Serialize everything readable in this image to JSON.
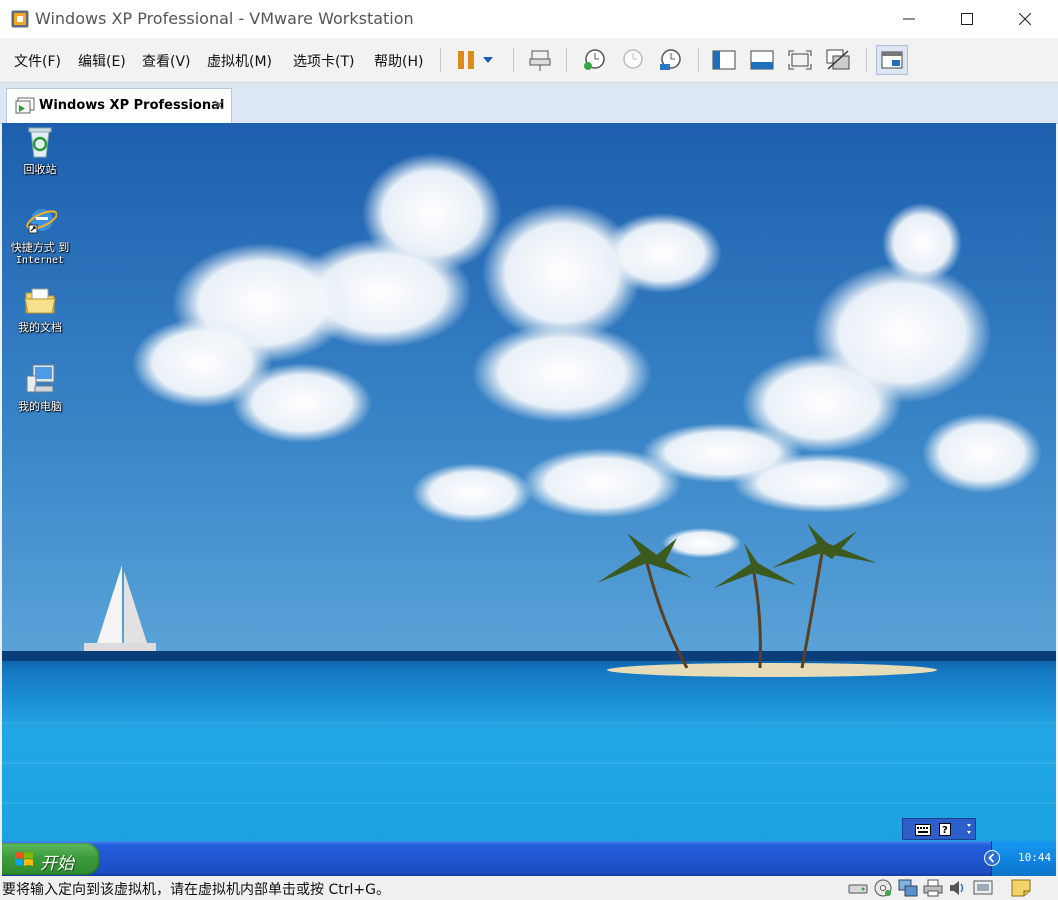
{
  "window": {
    "title": "Windows XP Professional - VMware Workstation",
    "icon": "vmware-icon",
    "controls": [
      "minimize-icon",
      "maximize-icon",
      "close-icon"
    ]
  },
  "menu": {
    "file": "文件(F)",
    "edit": "编辑(E)",
    "view": "查看(V)",
    "vm": "虚拟机(M)",
    "tabs": "选项卡(T)",
    "help": "帮助(H)"
  },
  "toolbar": {
    "buttons": [
      "pause-icon",
      "dropdown-arrow-icon",
      "send-keys-icon",
      "snapshot-take-icon",
      "snapshot-revert-icon",
      "snapshot-manager-icon",
      "show-library-icon",
      "thumbnail-bar-icon",
      "fullscreen-icon",
      "unity-icon",
      "console-view-icon"
    ],
    "accent": "#e08a1a"
  },
  "tab": {
    "label": "Windows XP Professional",
    "close": "×"
  },
  "desktop": {
    "icons": [
      {
        "label": "回收站",
        "icon": "recycle-bin-icon"
      },
      {
        "label_line1": "快捷方式 到",
        "label_line2": "Internet",
        "icon": "internet-explorer-icon"
      },
      {
        "label": "我的文档",
        "icon": "my-documents-icon"
      },
      {
        "label": "我的电脑",
        "icon": "my-computer-icon"
      }
    ]
  },
  "taskbar": {
    "start_label": "开始",
    "clock": "10:44",
    "colors": {
      "taskbar": "#245edb",
      "start": "#3c9c3c",
      "tray": "#0f86e3"
    }
  },
  "status": {
    "text": "要将输入定向到该虚拟机，请在虚拟机内部单击或按 Ctrl+G。",
    "icons": [
      "hard-disk-icon",
      "cd-rom-icon",
      "network-icon",
      "printer-icon",
      "sound-icon",
      "display-icon",
      "message-icon"
    ]
  }
}
